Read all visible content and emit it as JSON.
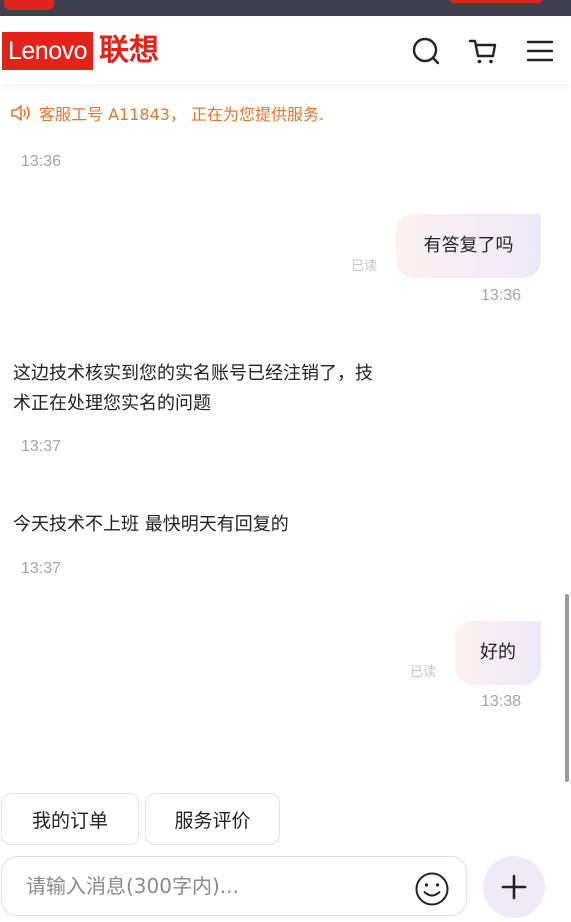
{
  "header": {
    "logo_en": "Lenovo",
    "logo_cn": "联想",
    "icons": [
      "search-icon",
      "cart-icon",
      "menu-icon"
    ]
  },
  "notice": {
    "text": "客服工号 A11843， 正在为您提供服务."
  },
  "messages": [
    {
      "side": "left",
      "time": "13:36"
    },
    {
      "side": "right",
      "text": "有答复了吗",
      "status": "已读",
      "time": "13:36"
    },
    {
      "side": "left",
      "text_line1": "这边技术核实到您的实名账号已经注销了，技",
      "text_line2": "术正在处理您实名的问题",
      "time": "13:37"
    },
    {
      "side": "left",
      "text": "今天技术不上班 最快明天有回复的",
      "time": "13:37"
    },
    {
      "side": "right",
      "text": "好的",
      "status": "已读",
      "time": "13:38"
    }
  ],
  "quick_actions": [
    "我的订单",
    "服务评价"
  ],
  "composer": {
    "placeholder": "请输入消息(300字内)...",
    "icons": [
      "emoji-icon",
      "plus-icon"
    ]
  },
  "colors": {
    "brand_red": "#e2231a",
    "notice_orange": "#e8742a",
    "timestamp_gray": "#a3a3a3"
  }
}
